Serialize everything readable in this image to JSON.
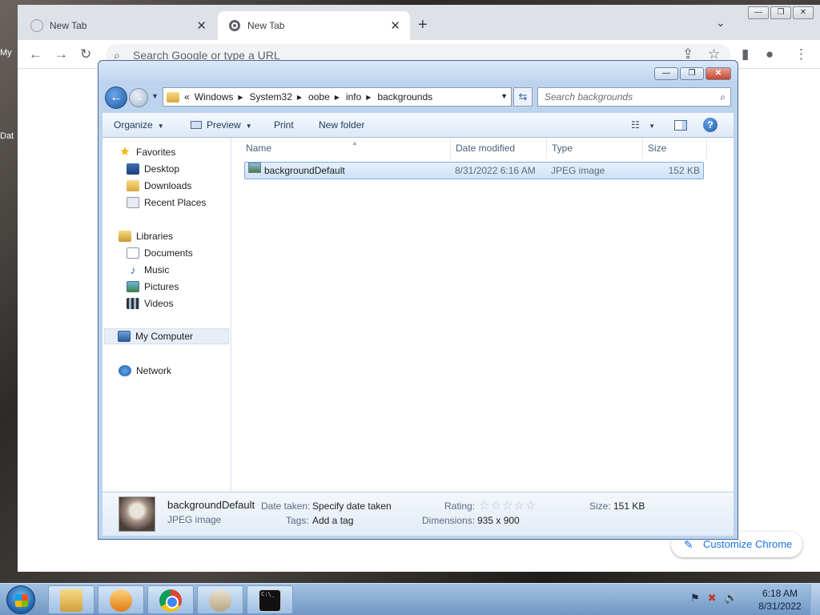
{
  "desktop": {
    "icon_fragments": [
      "My",
      "Dat"
    ]
  },
  "chrome": {
    "tabs": [
      {
        "label": "New Tab",
        "active": false
      },
      {
        "label": "New Tab",
        "active": true
      }
    ],
    "new_tab": "+",
    "tab_search": "⌄",
    "window_buttons": [
      "—",
      "❐",
      "✕"
    ],
    "omnibox_placeholder": "Search Google or type a URL",
    "customize_label": "Customize Chrome"
  },
  "explorer": {
    "breadcrumbs": [
      "Windows",
      "System32",
      "oobe",
      "info",
      "backgrounds"
    ],
    "search_placeholder": "Search backgrounds",
    "commands": {
      "organize": "Organize",
      "preview": "Preview",
      "print": "Print",
      "new_folder": "New folder"
    },
    "nav": {
      "favorites": "Favorites",
      "desktop": "Desktop",
      "downloads": "Downloads",
      "recent": "Recent Places",
      "libraries": "Libraries",
      "documents": "Documents",
      "music": "Music",
      "pictures": "Pictures",
      "videos": "Videos",
      "computer": "My Computer",
      "network": "Network"
    },
    "columns": {
      "name": "Name",
      "date": "Date modified",
      "type": "Type",
      "size": "Size"
    },
    "files": [
      {
        "name": "backgroundDefault",
        "date": "8/31/2022 6:16 AM",
        "type": "JPEG image",
        "size": "152 KB"
      }
    ],
    "details": {
      "name": "backgroundDefault",
      "type": "JPEG image",
      "date_taken_label": "Date taken:",
      "date_taken_value": "Specify date taken",
      "tags_label": "Tags:",
      "tags_value": "Add a tag",
      "rating_label": "Rating:",
      "rating_stars": "☆☆☆☆☆",
      "dimensions_label": "Dimensions:",
      "dimensions_value": "935 x 900",
      "size_label": "Size:",
      "size_value": "151 KB"
    }
  },
  "taskbar": {
    "clock_time": "6:18 AM",
    "clock_date": "8/31/2022",
    "cmd_glyph": "C:\\_"
  }
}
